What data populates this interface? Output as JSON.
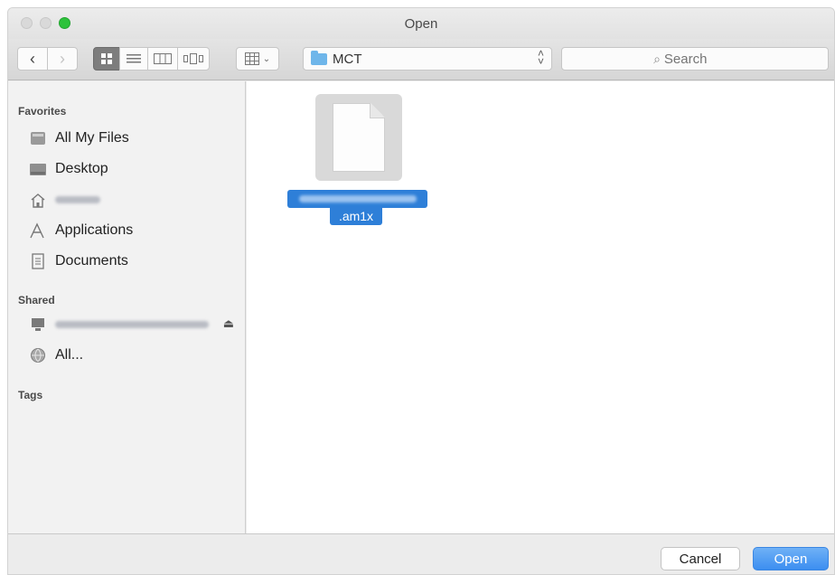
{
  "window": {
    "title": "Open"
  },
  "toolbar": {
    "back_icon": "chevron-left",
    "forward_icon": "chevron-right",
    "view_modes": [
      "icon-view",
      "list-view",
      "column-view",
      "coverflow-view"
    ],
    "arrange_icon": "arrange-grid",
    "location": "MCT",
    "search_placeholder": "Search"
  },
  "sidebar": {
    "favorites_header": "Favorites",
    "favorites": [
      {
        "label": "All My Files",
        "icon": "all-files-icon"
      },
      {
        "label": "Desktop",
        "icon": "desktop-icon"
      },
      {
        "label": "",
        "icon": "home-icon"
      },
      {
        "label": "Applications",
        "icon": "applications-icon"
      },
      {
        "label": "Documents",
        "icon": "documents-icon"
      }
    ],
    "shared_header": "Shared",
    "shared": [
      {
        "label": "",
        "icon": "computer-icon"
      },
      {
        "label": "All...",
        "icon": "network-icon"
      }
    ],
    "tags_header": "Tags"
  },
  "main": {
    "files": [
      {
        "name_suffix": ".am1x",
        "selected": true
      }
    ]
  },
  "footer": {
    "cancel_label": "Cancel",
    "open_label": "Open"
  },
  "colors": {
    "accent": "#3c8ef0",
    "selection": "#2e7fd8",
    "close_traffic": "#2dc23b"
  }
}
